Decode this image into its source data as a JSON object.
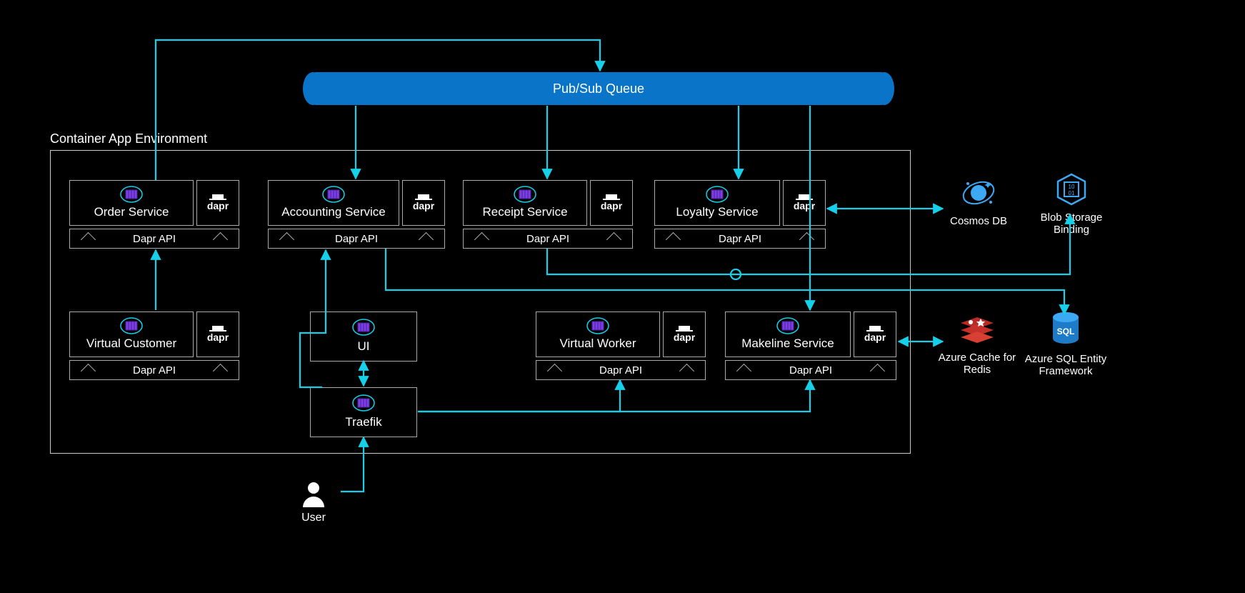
{
  "queue_label": "Pub/Sub Queue",
  "env_label": "Container App Environment",
  "api_label": "Dapr API",
  "dapr_label": "dapr",
  "services": {
    "order": {
      "label": "Order Service"
    },
    "accounting": {
      "label": "Accounting Service"
    },
    "receipt": {
      "label": "Receipt Service"
    },
    "loyalty": {
      "label": "Loyalty Service"
    },
    "vcustomer": {
      "label": "Virtual Customer"
    },
    "vworker": {
      "label": "Virtual Worker"
    },
    "makeline": {
      "label": "Makeline Service"
    },
    "ui": {
      "label": "UI"
    },
    "traefik": {
      "label": "Traefik"
    }
  },
  "externals": {
    "cosmos": {
      "label": "Cosmos DB"
    },
    "blob": {
      "label": "Blob Storage Binding"
    },
    "redis": {
      "label": "Azure Cache for Redis"
    },
    "sql": {
      "label": "Azure SQL Entity Framework"
    }
  },
  "user_label": "User",
  "colors": {
    "arrow": "#15d0e8",
    "queue": "#0a74c8"
  }
}
